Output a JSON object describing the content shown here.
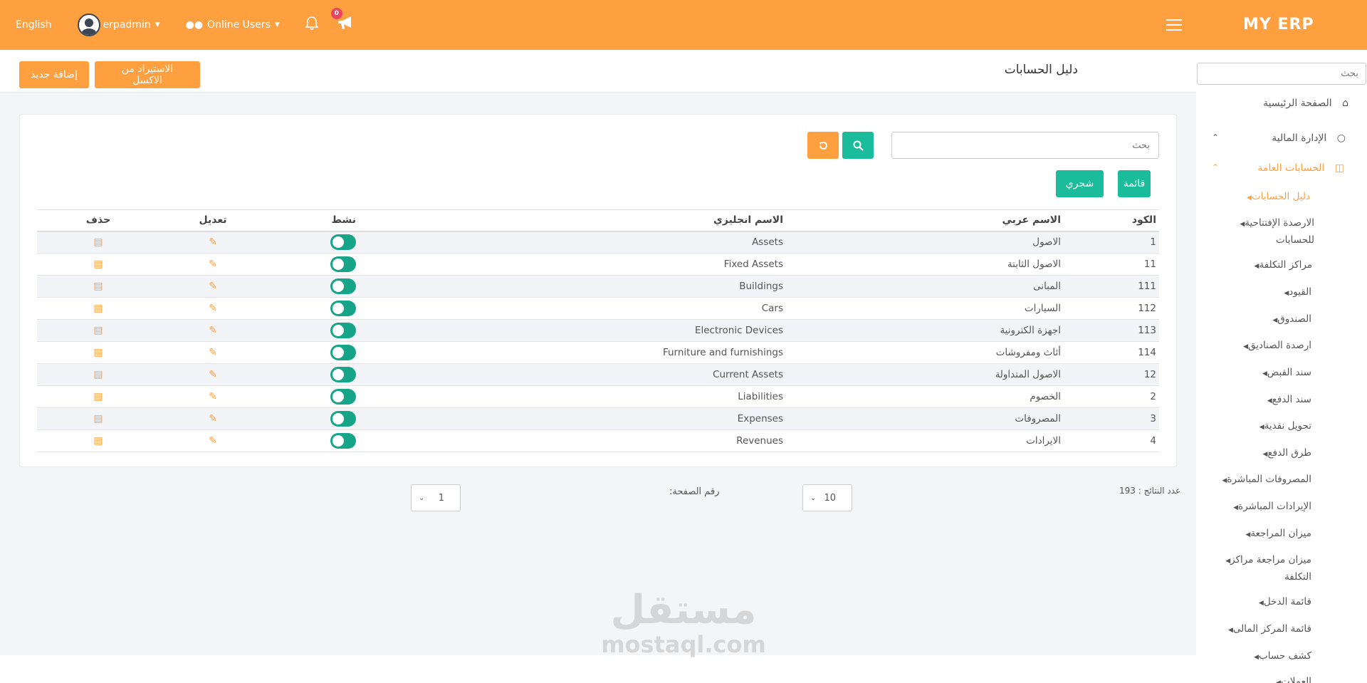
{
  "topbar": {
    "language": "English",
    "username": "erpadmin",
    "online_users": "Online Users",
    "notification_count": "0",
    "brand": "MY ERP"
  },
  "sidebar": {
    "search_placeholder": "بحث",
    "home": "الصفحة الرئيسية",
    "finance": "الإدارة المالية",
    "general_accounts": "الحسابات العامة",
    "items": [
      "دليل الحسابات",
      "الارصدة الإفتتاحية للحسابات",
      "مراكز التكلفة",
      "القيود",
      "الصندوق",
      "ارصدة الصناديق",
      "سند القبض",
      "سند الدفع",
      "تحويل نقدية",
      "طرق الدفع",
      "المصروفات المباشرة",
      "الإيرادات المباشرة",
      "ميزان المراجعة",
      "ميزان مراجعة مراكز التكلفة",
      "قائمة الدخل",
      "قائمة المركز المالى",
      "كشف حساب",
      "العملات"
    ]
  },
  "page": {
    "title": "دليل الحسابات",
    "import_excel": "الاستيراد من الاكسل",
    "add_new": "إضافة جديد",
    "search_placeholder": "بحث",
    "view_list": "قائمة",
    "view_tree": "شجري"
  },
  "table": {
    "headers": {
      "code": "الكود",
      "arabic_name": "الاسم عربي",
      "english_name": "الاسم انجليزي",
      "active": "نشط",
      "edit": "تعديل",
      "delete": "حذف"
    },
    "rows": [
      {
        "code": "1",
        "ar": "الاصول",
        "en": "Assets",
        "active": true
      },
      {
        "code": "11",
        "ar": "الاصول الثابتة",
        "en": "Fixed Assets",
        "active": true
      },
      {
        "code": "111",
        "ar": "المبانى",
        "en": "Buildings",
        "active": true
      },
      {
        "code": "112",
        "ar": "السيارات",
        "en": "Cars",
        "active": true
      },
      {
        "code": "113",
        "ar": "اجهزة الكترونية",
        "en": "Electronic Devices",
        "active": true
      },
      {
        "code": "114",
        "ar": "أثاث ومفروشات",
        "en": "Furniture and furnishings",
        "active": true
      },
      {
        "code": "12",
        "ar": "الاصول المتداولة",
        "en": "Current Assets",
        "active": true
      },
      {
        "code": "2",
        "ar": "الخصوم",
        "en": "Liabilities",
        "active": true
      },
      {
        "code": "3",
        "ar": "المصروفات",
        "en": "Expenses",
        "active": true
      },
      {
        "code": "4",
        "ar": "الايرادات",
        "en": "Revenues",
        "active": true
      }
    ]
  },
  "pagination": {
    "total_label": "عدد النتائج : 193",
    "page_size": "10",
    "page_label": "رقم الصفحة:",
    "page_number": "1"
  },
  "watermark": {
    "arabic": "مستقل",
    "latin": "mostaql.com"
  },
  "colors": {
    "primary": "#ffa040",
    "teal": "#1abc9c",
    "toggle": "#17a589"
  }
}
